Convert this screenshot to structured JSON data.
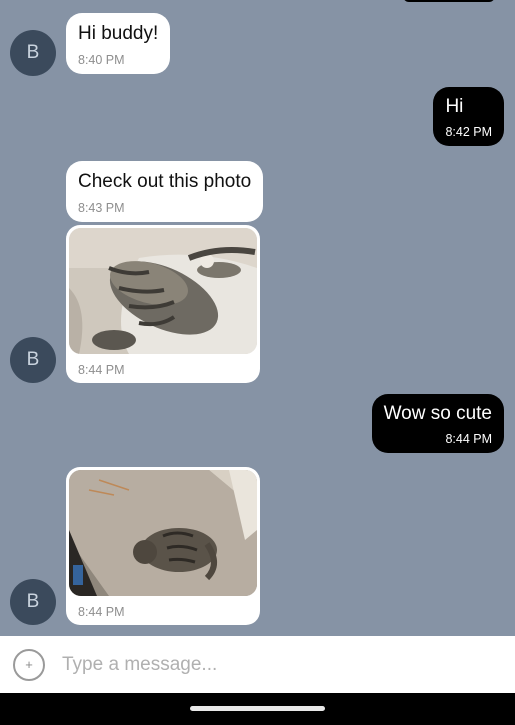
{
  "contact": {
    "avatar_initial": "B"
  },
  "messages": [
    {
      "text": "Hi buddy!",
      "time": "8:40 PM"
    },
    {
      "text": "Hi",
      "time": "8:42 PM"
    },
    {
      "text": "Check out this photo",
      "time": "8:43 PM"
    },
    {
      "photo": "cat-lying-on-rug",
      "time": "8:44 PM"
    },
    {
      "text": "Wow so cute",
      "time": "8:44 PM"
    },
    {
      "photo": "cat-on-stair",
      "time": "8:44 PM"
    }
  ],
  "composer": {
    "placeholder": "Type a message...",
    "add_icon": "plus-circle-icon"
  },
  "colors": {
    "background": "#8693a5",
    "incoming_bubble": "#ffffff",
    "outgoing_bubble": "#000000",
    "avatar": "#3b4a5c"
  }
}
